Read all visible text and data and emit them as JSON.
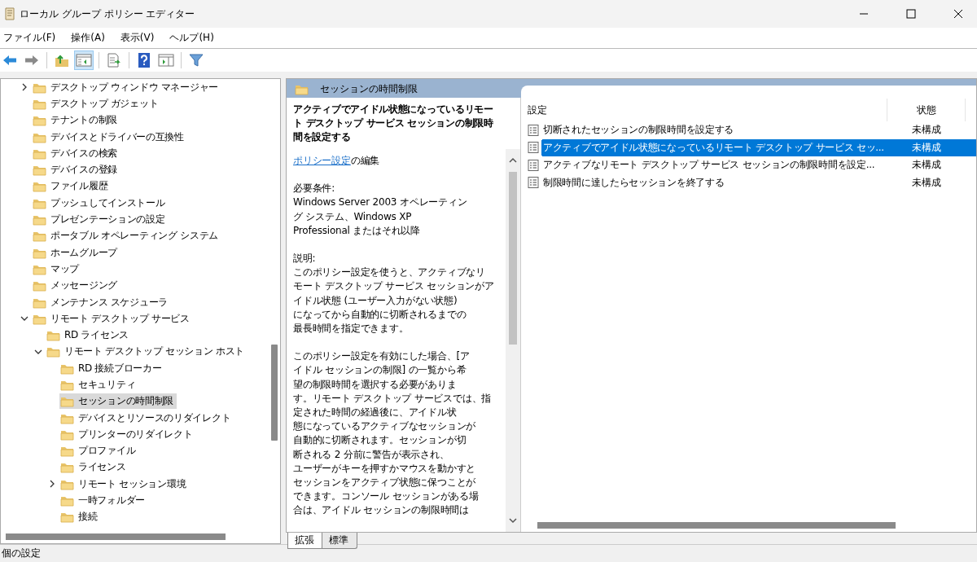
{
  "window": {
    "title": "ローカル グループ ポリシー エディター"
  },
  "menu": [
    "ファイル(F)",
    "操作(A)",
    "表示(V)",
    "ヘルプ(H)"
  ],
  "toolbar": [
    {
      "kind": "back",
      "pressed": false
    },
    {
      "kind": "forward",
      "pressed": false
    },
    {
      "kind": "sep"
    },
    {
      "kind": "up",
      "pressed": false
    },
    {
      "kind": "tree",
      "pressed": true
    },
    {
      "kind": "sep"
    },
    {
      "kind": "export",
      "pressed": false
    },
    {
      "kind": "sep"
    },
    {
      "kind": "help",
      "pressed": false
    },
    {
      "kind": "pane",
      "pressed": false
    },
    {
      "kind": "sep"
    },
    {
      "kind": "filter",
      "pressed": false
    }
  ],
  "tree": {
    "items": [
      {
        "label": "デスクトップ ウィンドウ マネージャー",
        "kind": "branch",
        "expanded": false,
        "selected": false
      },
      {
        "label": "デスクトップ ガジェット",
        "kind": "leaf",
        "selected": false
      },
      {
        "label": "テナントの制限",
        "kind": "leaf",
        "selected": false
      },
      {
        "label": "デバイスとドライバーの互換性",
        "kind": "leaf",
        "selected": false
      },
      {
        "label": "デバイスの検索",
        "kind": "leaf",
        "selected": false
      },
      {
        "label": "デバイスの登録",
        "kind": "leaf",
        "selected": false
      },
      {
        "label": "ファイル履歴",
        "kind": "leaf",
        "selected": false
      },
      {
        "label": "プッシュしてインストール",
        "kind": "leaf",
        "selected": false
      },
      {
        "label": "プレゼンテーションの設定",
        "kind": "leaf",
        "selected": false
      },
      {
        "label": "ポータブル オペレーティング システム",
        "kind": "leaf",
        "selected": false
      },
      {
        "label": "ホームグループ",
        "kind": "leaf",
        "selected": false
      },
      {
        "label": "マップ",
        "kind": "leaf",
        "selected": false
      },
      {
        "label": "メッセージング",
        "kind": "leaf",
        "selected": false
      },
      {
        "label": "メンテナンス スケジューラ",
        "kind": "leaf",
        "selected": false
      },
      {
        "label": "リモート デスクトップ サービス",
        "kind": "branch",
        "expanded": true,
        "selected": false,
        "children": [
          {
            "label": "RD ライセンス",
            "kind": "leaf",
            "selected": false
          },
          {
            "label": "リモート デスクトップ セッション ホスト",
            "kind": "branch",
            "expanded": true,
            "selected": false,
            "children": [
              {
                "label": "RD 接続ブローカー",
                "kind": "leaf",
                "selected": false
              },
              {
                "label": "セキュリティ",
                "kind": "leaf",
                "selected": false
              },
              {
                "label": "セッションの時間制限",
                "kind": "leaf",
                "selected": true
              },
              {
                "label": "デバイスとリソースのリダイレクト",
                "kind": "leaf",
                "selected": false
              },
              {
                "label": "プリンターのリダイレクト",
                "kind": "leaf",
                "selected": false
              },
              {
                "label": "プロファイル",
                "kind": "leaf",
                "selected": false
              },
              {
                "label": "ライセンス",
                "kind": "leaf",
                "selected": false
              },
              {
                "label": "リモート セッション環境",
                "kind": "branch",
                "expanded": false,
                "selected": false
              },
              {
                "label": "一時フォルダー",
                "kind": "leaf",
                "selected": false
              },
              {
                "label": "接続",
                "kind": "leaf",
                "selected": false
              }
            ]
          }
        ]
      }
    ]
  },
  "detail": {
    "header": "セッションの時間制限",
    "title": [
      "アクティブでアイドル状態になっているリモー",
      "ト デスクトップ サービス セッションの制限時",
      "間を設定する"
    ],
    "link": "ポリシー設定",
    "link_suffix": "の編集",
    "paragraphs": [
      [
        "必要条件:",
        "Windows Server 2003 オペレーティン",
        "グ システム、Windows XP",
        "Professional またはそれ以降"
      ],
      [
        "説明:",
        "このポリシー設定を使うと、アクティブなリ",
        "モート デスクトップ サービス セッションがア",
        "イドル状態 (ユーザー入力がない状態)",
        "になってから自動的に切断されるまでの",
        "最長時間を指定できます。"
      ],
      [
        "このポリシー設定を有効にした場合、[ア",
        "イドル セッションの制限] の一覧から希",
        "望の制限時間を選択する必要がありま",
        "す。リモート デスクトップ サービスでは、指",
        "定された時間の経過後に、アイドル状",
        "態になっているアクティブなセッションが",
        "自動的に切断されます。セッションが切",
        "断される 2 分前に警告が表示され、",
        "ユーザーがキーを押すかマウスを動かすと",
        "セッションをアクティブ状態に保つことが",
        "できます。コンソール セッションがある場",
        "合は、アイドル セッションの制限時間は"
      ]
    ]
  },
  "table": {
    "columns": [
      "設定",
      "状態"
    ],
    "rows": [
      {
        "setting": "切断されたセッションの制限時間を設定する",
        "state": "未構成",
        "selected": false
      },
      {
        "setting": "アクティブでアイドル状態になっているリモート デスクトップ サービス セッ...",
        "state": "未構成",
        "selected": true
      },
      {
        "setting": "アクティブなリモート デスクトップ サービス セッションの制限時間を設定...",
        "state": "未構成",
        "selected": false
      },
      {
        "setting": "制限時間に達したらセッションを終了する",
        "state": "未構成",
        "selected": false
      }
    ]
  },
  "tabs": [
    {
      "label": "拡張",
      "selected": true
    },
    {
      "label": "標準",
      "selected": false
    }
  ],
  "status_bar": "個の設定"
}
